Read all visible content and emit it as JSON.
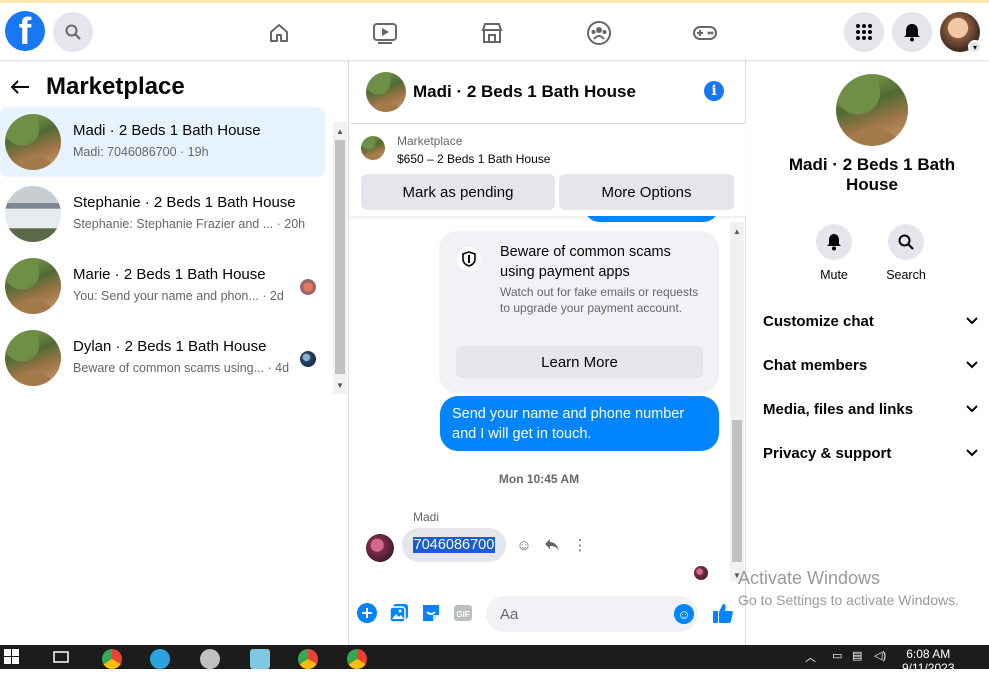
{
  "topbar": {
    "logo_letter": "f",
    "nav_icons": [
      "home-icon",
      "watch-icon",
      "marketplace-icon",
      "groups-icon",
      "gaming-icon"
    ],
    "right_icons": [
      "menu-grid-icon",
      "bell-icon",
      "account-avatar"
    ]
  },
  "left": {
    "title": "Marketplace",
    "conversations": [
      {
        "title": "Madi · 2 Beds 1 Bath House",
        "subtitle": "Madi: 7046086700 · 19h",
        "active": true
      },
      {
        "title": "Stephanie · 2 Beds 1 Bath House",
        "subtitle": "Stephanie: Stephanie Frazier and ... · 20h",
        "active": false
      },
      {
        "title": "Marie · 2 Beds 1 Bath House",
        "subtitle": "You: Send your name and phon... · 2d",
        "active": false
      },
      {
        "title": "Dylan · 2 Beds 1 Bath House",
        "subtitle": "Beware of common scams using... · 4d",
        "active": false
      }
    ]
  },
  "chat": {
    "header_title": "Madi · 2 Beds 1 Bath House",
    "listing": {
      "source": "Marketplace",
      "price_title": "$650 – 2 Beds 1 Bath House"
    },
    "buttons": {
      "mark_pending": "Mark as pending",
      "more_options": "More Options"
    },
    "scam_card": {
      "title": "Beware of common scams using payment apps",
      "body": "Watch out for fake emails or requests to upgrade your payment account.",
      "button": "Learn More"
    },
    "outgoing_message": "Send your name and phone number and I will get in touch.",
    "timestamp": "Mon 10:45 AM",
    "sender_name": "Madi",
    "incoming_message": "7046086700",
    "composer_placeholder": "Aa"
  },
  "right": {
    "title": "Madi · 2 Beds 1 Bath House",
    "actions": [
      {
        "label": "Mute"
      },
      {
        "label": "Search"
      }
    ],
    "sections": [
      "Customize chat",
      "Chat members",
      "Media, files and links",
      "Privacy & support"
    ]
  },
  "watermark": {
    "line1": "Activate Windows",
    "line2": "Go to Settings to activate Windows."
  },
  "taskbar": {
    "time": "6:08 AM",
    "date": "9/11/2023"
  },
  "colors": {
    "accent": "#1877f2",
    "messenger_blue": "#0084ff",
    "active_row": "#e7f3ff"
  }
}
